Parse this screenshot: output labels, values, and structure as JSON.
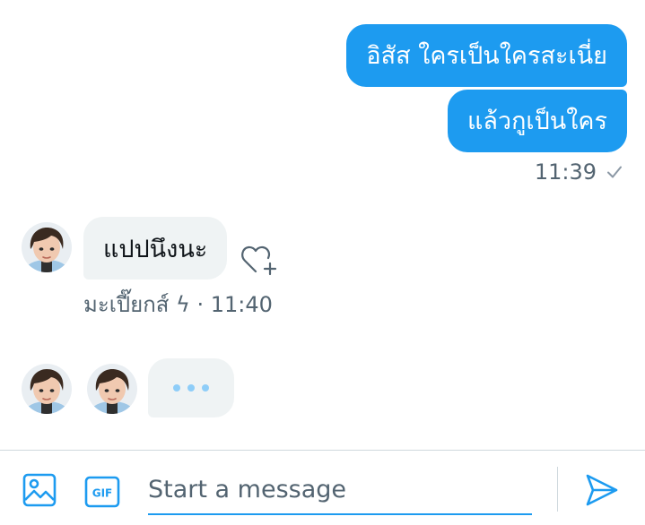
{
  "conversation": {
    "sent_messages": [
      {
        "text": "อิสัส ใครเป็นใครสะเนี่ย"
      },
      {
        "text": "แล้วกูเป็นใคร"
      }
    ],
    "sent_time": "11:39",
    "received_message": {
      "text": "แปปนึงนะ"
    },
    "received_meta": "มะเปี๊ยกส์ ϟ · 11:40"
  },
  "composer": {
    "placeholder": "Start a message",
    "gif_label": "GIF"
  },
  "colors": {
    "accent": "#1d9bf0",
    "bubble_gray": "#eff3f4",
    "meta_text": "#536471",
    "typing_dots": "#8ecdf8"
  },
  "icons": [
    "check-icon",
    "avatar",
    "heart-plus-icon",
    "image-icon",
    "gif-icon",
    "send-icon"
  ]
}
